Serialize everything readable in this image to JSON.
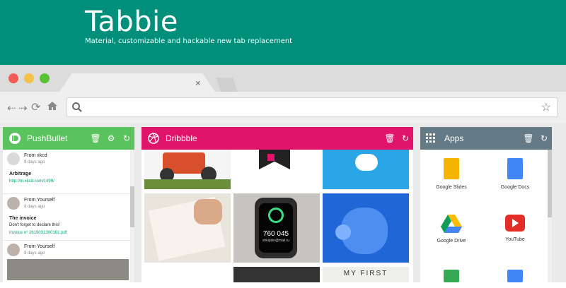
{
  "hero": {
    "title": "Tabbie",
    "subtitle": "Material, customizable and hackable new tab replacement"
  },
  "browser": {
    "tab_close": "×",
    "omnibox_placeholder": ""
  },
  "pushbullet": {
    "title": "PushBullet",
    "messages": [
      {
        "from": "From xkcd",
        "time": "8 days ago",
        "title": "Arbitrage",
        "body": "",
        "link": "http://m.xkcd.com/1499/"
      },
      {
        "from": "From Yourself",
        "time": "8 days ago",
        "title": "The invoice",
        "body": "Don't forget to declare this!",
        "link": "Invoice n° 2619031300161.pdf"
      },
      {
        "from": "From Yourself",
        "time": "8 days ago",
        "title": "",
        "body": "",
        "link": ""
      }
    ]
  },
  "dribbble": {
    "title": "Dribbble",
    "watch_time": "760 045",
    "watch_sub": "shkipsin@mail.ru",
    "poster_text": "MY FIRST"
  },
  "apps": {
    "title": "Apps",
    "items": [
      {
        "label": "Google Slides",
        "color": "#f4b400"
      },
      {
        "label": "Google Docs",
        "color": "#4285f4"
      },
      {
        "label": "Google Drive",
        "color": "#0f9d58"
      },
      {
        "label": "YouTube",
        "color": "#e52d27"
      },
      {
        "label": "",
        "color": "#34a853"
      },
      {
        "label": "",
        "color": "#4285f4"
      }
    ]
  },
  "colors": {
    "hero": "#008f7a",
    "pushbullet": "#5bc35e",
    "dribbble": "#e0146b",
    "apps": "#647a87"
  }
}
